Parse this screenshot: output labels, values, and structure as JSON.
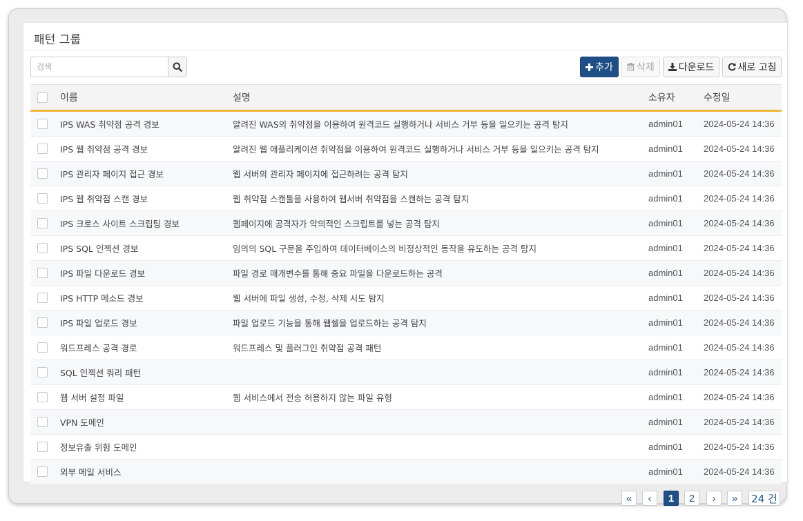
{
  "panel": {
    "title": "패턴 그룹"
  },
  "search": {
    "placeholder": "검색",
    "icon": "search-icon"
  },
  "toolbar": {
    "add_label": "추가",
    "delete_label": "삭제",
    "download_label": "다운로드",
    "refresh_label": "새로 고침"
  },
  "table": {
    "columns": {
      "name": "이름",
      "description": "설명",
      "owner": "소유자",
      "modified": "수정일"
    },
    "rows": [
      {
        "name": "IPS WAS 취약점 공격 경보",
        "description": "알려진 WAS의 취약점을 이용하여 원격코드 실행하거나 서비스 거부 등을 일으키는 공격 탐지",
        "owner": "admin01",
        "modified": "2024-05-24 14:36"
      },
      {
        "name": "IPS 웹 취약점 공격 경보",
        "description": "알려진 웹 애플리케이션 취약점을 이용하여 원격코드 실행하거나 서비스 거부 등을 일으키는 공격 탐지",
        "owner": "admin01",
        "modified": "2024-05-24 14:36"
      },
      {
        "name": "IPS 관리자 페이지 접근 경보",
        "description": "웹 서버의 관리자 페이지에 접근하려는 공격 탐지",
        "owner": "admin01",
        "modified": "2024-05-24 14:36"
      },
      {
        "name": "IPS 웹 취약점 스캔 경보",
        "description": "웹 취약점 스캔툴을 사용하여 웹서버 취약점을 스캔하는 공격 탐지",
        "owner": "admin01",
        "modified": "2024-05-24 14:36"
      },
      {
        "name": "IPS 크로스 사이트 스크립팅 경보",
        "description": "웹페이지에 공격자가 악의적인 스크립트를 넣는 공격 탐지",
        "owner": "admin01",
        "modified": "2024-05-24 14:36"
      },
      {
        "name": "IPS SQL 인젝션 경보",
        "description": "임의의 SQL 구문을 주입하여 데이터베이스의 비정상적인 동작을 유도하는 공격 탐지",
        "owner": "admin01",
        "modified": "2024-05-24 14:36"
      },
      {
        "name": "IPS 파일 다운로드 경보",
        "description": "파일 경로 매개변수를 통해 중요 파일을 다운로드하는 공격",
        "owner": "admin01",
        "modified": "2024-05-24 14:36"
      },
      {
        "name": "IPS HTTP 메소드 경보",
        "description": "웹 서버에 파일 생성, 수정, 삭제 시도 탐지",
        "owner": "admin01",
        "modified": "2024-05-24 14:36"
      },
      {
        "name": "IPS 파일 업로드 경보",
        "description": "파일 업로드 기능을 통해 웹쉘을 업로드하는 공격 탐지",
        "owner": "admin01",
        "modified": "2024-05-24 14:36"
      },
      {
        "name": "워드프레스 공격 경로",
        "description": "워드프레스 및 플러그인 취약점 공격 패턴",
        "owner": "admin01",
        "modified": "2024-05-24 14:36"
      },
      {
        "name": "SQL 인젝션 쿼리 패턴",
        "description": "",
        "owner": "admin01",
        "modified": "2024-05-24 14:36"
      },
      {
        "name": "웹 서버 설정 파일",
        "description": "웹 서비스에서 전송 허용하지 않는 파일 유형",
        "owner": "admin01",
        "modified": "2024-05-24 14:36"
      },
      {
        "name": "VPN 도메인",
        "description": "",
        "owner": "admin01",
        "modified": "2024-05-24 14:36"
      },
      {
        "name": "정보유출 위험 도메인",
        "description": "",
        "owner": "admin01",
        "modified": "2024-05-24 14:36"
      },
      {
        "name": "외부 메일 서비스",
        "description": "",
        "owner": "admin01",
        "modified": "2024-05-24 14:36"
      }
    ]
  },
  "pagination": {
    "first": "«",
    "prev": "‹",
    "pages": [
      "1",
      "2"
    ],
    "current": "1",
    "next": "›",
    "last": "»",
    "total": "24 건"
  },
  "colors": {
    "accent": "#1f4f86",
    "header_underline": "#f0b63a"
  }
}
